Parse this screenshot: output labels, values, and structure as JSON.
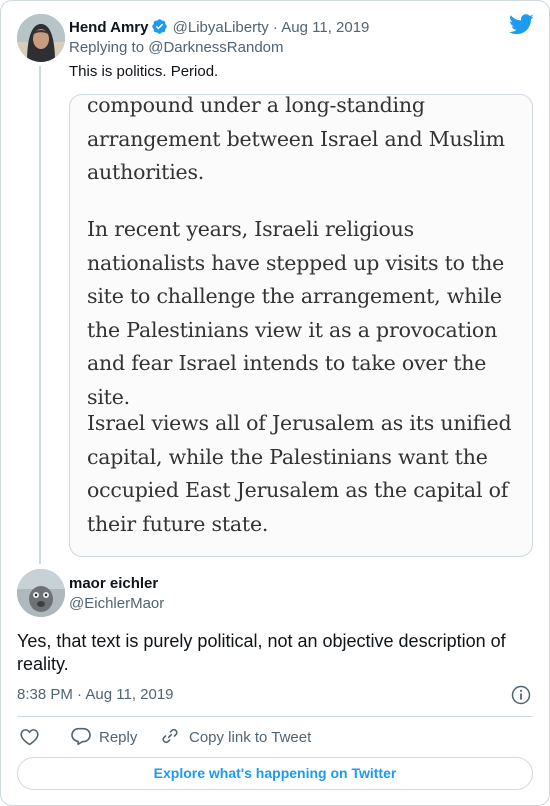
{
  "parent_tweet": {
    "author_name": "Hend Amry",
    "handle": "@LibyaLiberty",
    "separator": "·",
    "date": "Aug 11, 2019",
    "replying_to_prefix": "Replying to",
    "replying_to_handle": "@DarknessRandom",
    "text": "This is politics. Period.",
    "quoted_image_paragraphs": [
      "compound under a long-standing arrangement between Israel and Muslim authorities.",
      "In recent years, Israeli religious nationalists have stepped up visits to the site to challenge the arrangement, while the Palestinians view it as a provocation and fear Israel intends to take over the site.",
      "Israel views all of Jerusalem as its unified capital, while the Palestinians want the occupied East Jerusalem as the capital of their future state."
    ]
  },
  "reply_tweet": {
    "author_name": "maor eichler",
    "handle": "@EichlerMaor",
    "text": "Yes, that text is purely political, not an objective description of reality.",
    "time": "8:38 PM",
    "separator": "·",
    "date": "Aug 11, 2019"
  },
  "actions": {
    "reply_label": "Reply",
    "copy_link_label": "Copy link to Tweet"
  },
  "explore_label": "Explore what's happening on Twitter",
  "colors": {
    "accent": "#1d9bf0",
    "secondary_text": "#536471",
    "border": "#cfd9de",
    "heart_red": "#f91880"
  },
  "icons": [
    "twitter-bird-icon",
    "verified-badge-icon",
    "info-icon",
    "heart-icon",
    "reply-icon",
    "link-icon"
  ]
}
